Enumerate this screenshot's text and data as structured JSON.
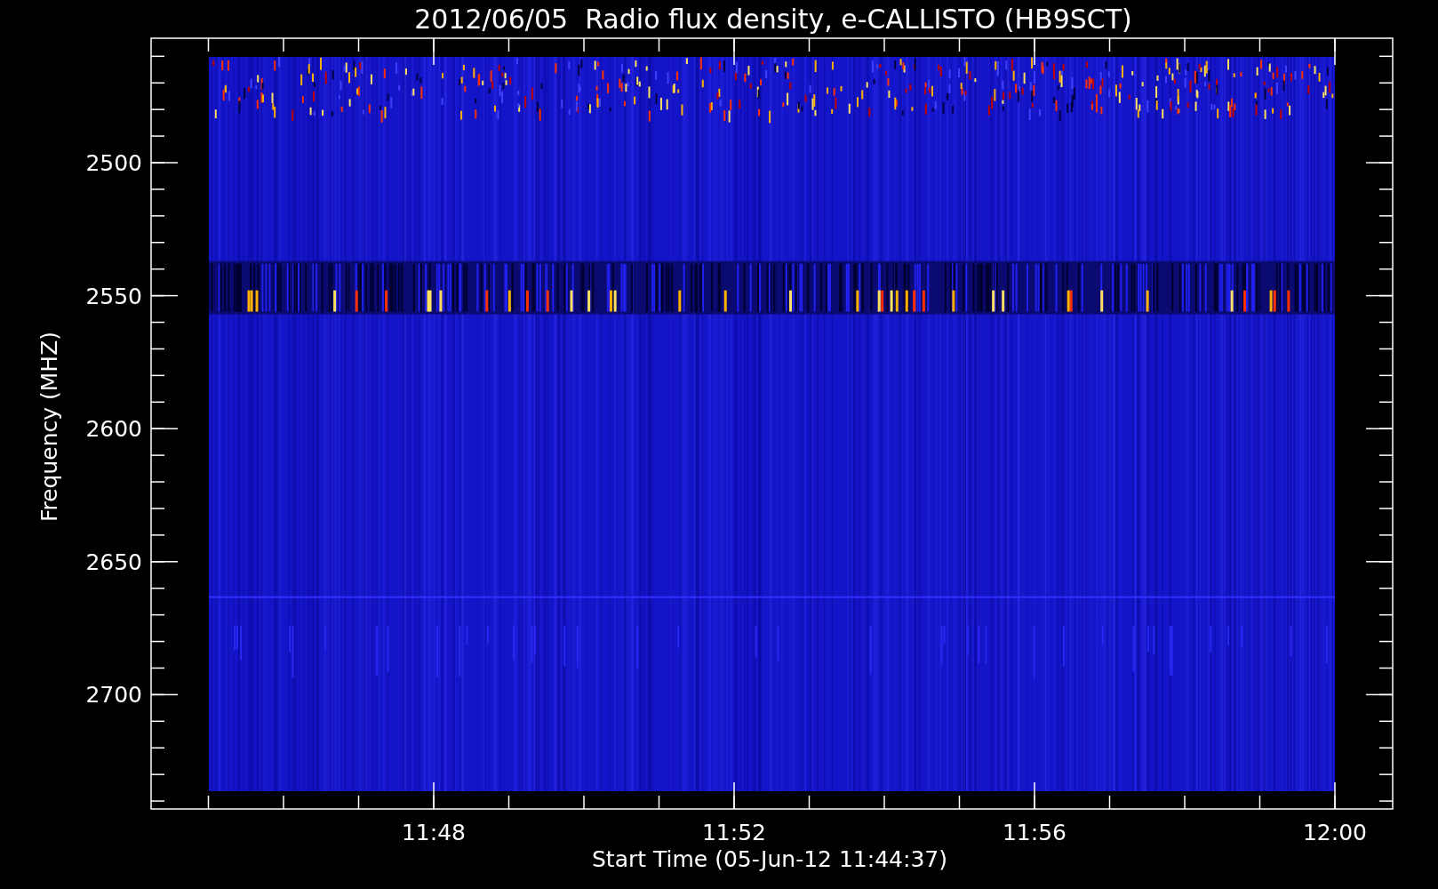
{
  "title": "2012/06/05  Radio flux density, e-CALLISTO (HB9SCT)",
  "y_axis": {
    "label": "Frequency (MHZ)",
    "ticks": [
      "2500",
      "2550",
      "2600",
      "2650",
      "2700"
    ]
  },
  "x_axis": {
    "label": "Start Time (05-Jun-12 11:44:37)",
    "ticks": [
      "11:48",
      "11:52",
      "11:56",
      "12:00"
    ]
  }
}
